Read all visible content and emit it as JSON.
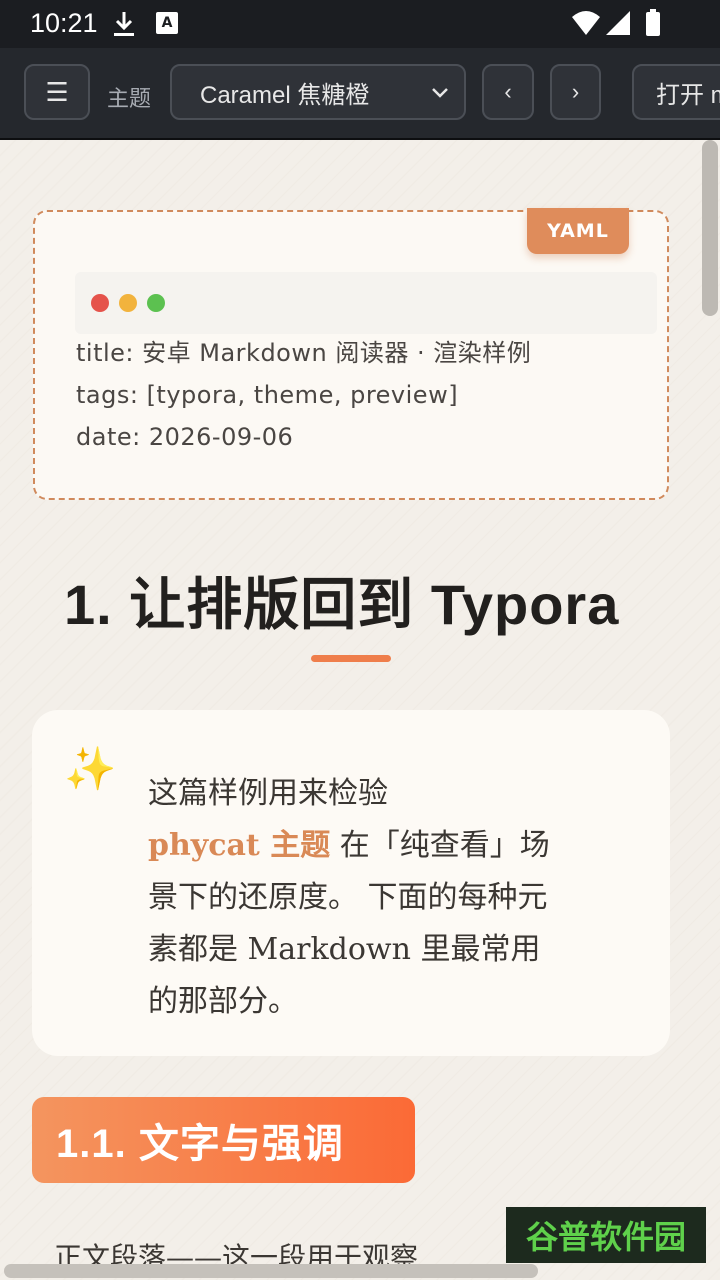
{
  "status_bar": {
    "time": "10:21"
  },
  "toolbar": {
    "menu_icon": "☰",
    "theme_label": "主题",
    "theme_value": "Caramel 焦糖橙",
    "prev": "‹",
    "next": "›",
    "open_label": "打开 m"
  },
  "yaml": {
    "badge": "YAML",
    "lines": [
      "title: 安卓 Markdown 阅读器 · 渲染样例",
      "tags: [typora, theme, preview]",
      "date: 2026-09-06"
    ],
    "dot_colors": [
      "#e5534b",
      "#f2b33d",
      "#5cc150"
    ]
  },
  "heading1": "1. 让排版回到 Typora",
  "callout": {
    "icon": "✨",
    "line1": "这篇样例用来检验",
    "strong": "phycat 主题",
    "line2_rest": " 在「纯查看」场",
    "line3": "景下的还原度。 下面的每种元",
    "line4": "素都是 Markdown 里最常用",
    "line5": "的那部分。"
  },
  "heading2": "1.1. 文字与强调",
  "paragraph_start": "正文段落——这一段用于观察",
  "watermark": "谷普软件园",
  "colors": {
    "accent": "#df8c5b",
    "heading2_start": "#f4955f",
    "heading2_end": "#fb6a36"
  }
}
